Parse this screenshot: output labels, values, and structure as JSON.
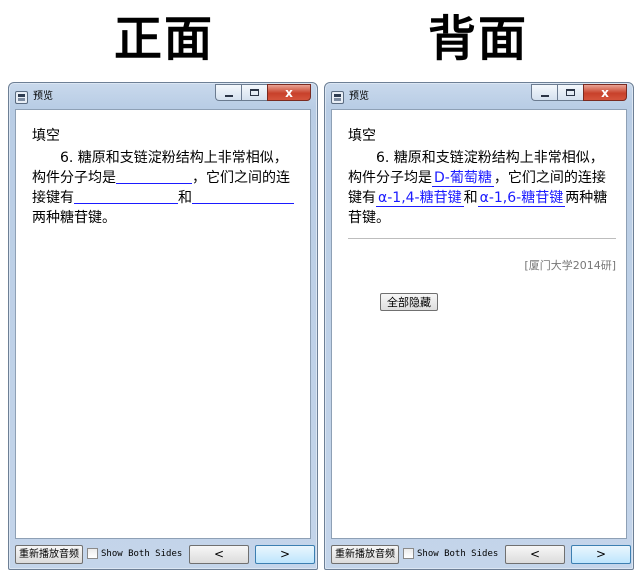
{
  "labels": {
    "front": "正面",
    "back": "背面"
  },
  "window": {
    "title": "预览",
    "icon": "app-icon",
    "min_icon": "minimize-icon",
    "max_icon": "maximize-icon",
    "close_symbol": "x"
  },
  "card": {
    "type_label": "填空",
    "number": "6.",
    "text_part1": " 糖原和支链淀粉结构上非常相似，构件分子均是",
    "text_part2": "，它们之间的连接键有",
    "text_part3": "和",
    "text_part4": "两种糖苷键。",
    "answers": [
      "D-葡萄糖",
      "α-1,4-糖苷键",
      "α-1,6-糖苷键"
    ],
    "source": "[厦门大学2014研]",
    "hide_all_label": "全部隐藏"
  },
  "bottom": {
    "replay_label": "重新播放音频",
    "show_both_label": "Show Both Sides",
    "show_both_checked": false,
    "prev_label": "<",
    "next_label": ">"
  },
  "colors": {
    "answer": "#1b1bff",
    "close_button": "#c8412b"
  }
}
